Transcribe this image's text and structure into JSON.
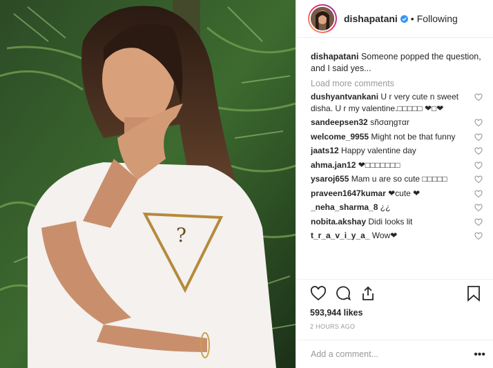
{
  "header": {
    "username": "dishapatani",
    "separator": "•",
    "follow_state": "Following"
  },
  "caption": {
    "username": "dishapatani",
    "text": "Someone popped the question, and I said yes..."
  },
  "load_more": "Load more comments",
  "comments": [
    {
      "user": "dushyantvankani",
      "text": "U r very cute n sweet disha. U r my valentine.□□□□□ ❤□❤"
    },
    {
      "user": "sandeepsen32",
      "text": "ѕñσαηgтαr"
    },
    {
      "user": "welcome_9955",
      "text": "Might not be that funny"
    },
    {
      "user": "jaats12",
      "text": "Happy valentine day"
    },
    {
      "user": "ahma.jan12",
      "text": "❤□□□□□□□"
    },
    {
      "user": "ysaroj655",
      "text": "Mam u are so cute □□□□□"
    },
    {
      "user": "praveen1647kumar",
      "text": "❤cute ❤"
    },
    {
      "user": "_neha_sharma_8",
      "text": "¿¿"
    },
    {
      "user": "nobita.akshay",
      "text": "Didi looks lit"
    },
    {
      "user": "t_r_a_v_i_y_a_",
      "text": "Wow❤"
    }
  ],
  "likes": "593,944 likes",
  "time": "2 HOURS AGO",
  "add_comment": {
    "placeholder": "Add a comment...",
    "more_label": "•••"
  },
  "colors": {
    "verified": "#3897f0",
    "muted": "#999999",
    "border": "#efefef"
  },
  "icons": {
    "like": "heart-icon",
    "comment": "comment-bubble-icon",
    "share": "share-icon",
    "save": "bookmark-icon"
  }
}
